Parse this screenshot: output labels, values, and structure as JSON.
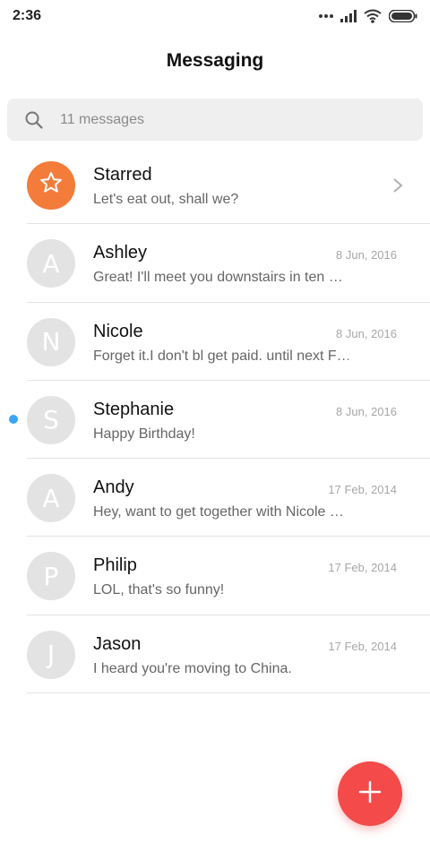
{
  "status_bar": {
    "time": "2:36",
    "icons": [
      "more-dots-icon",
      "signal-icon",
      "wifi-icon",
      "battery-icon"
    ]
  },
  "header": {
    "title": "Messaging"
  },
  "search": {
    "placeholder": "11 messages",
    "icon": "search-icon"
  },
  "colors": {
    "accent": "#f37c3a",
    "fab": "#f44a4a",
    "unread": "#3ba5f3",
    "avatar_bg": "#e3e3e3"
  },
  "starred": {
    "title": "Starred",
    "preview": "Let's eat out, shall we?",
    "icon": "star-icon"
  },
  "conversations": [
    {
      "initial": "A",
      "name": "Ashley",
      "preview": "Great! I'll meet you downstairs in ten …",
      "date": "8 Jun, 2016",
      "unread": false
    },
    {
      "initial": "N",
      "name": "Nicole",
      "preview": "Forget it.I don't bl get paid. until next F…",
      "date": "8 Jun, 2016",
      "unread": false
    },
    {
      "initial": "S",
      "name": "Stephanie",
      "preview": "Happy Birthday!",
      "date": "8 Jun, 2016",
      "unread": true
    },
    {
      "initial": "A",
      "name": "Andy",
      "preview": "Hey, want to get together with Nicole …",
      "date": "17 Feb, 2014",
      "unread": false
    },
    {
      "initial": "P",
      "name": "Philip",
      "preview": "LOL, that's so funny!",
      "date": "17 Feb, 2014",
      "unread": false
    },
    {
      "initial": "J",
      "name": "Jason",
      "preview": "I heard you're moving to China.",
      "date": "17 Feb, 2014",
      "unread": false
    }
  ],
  "fab": {
    "icon": "plus-icon"
  }
}
